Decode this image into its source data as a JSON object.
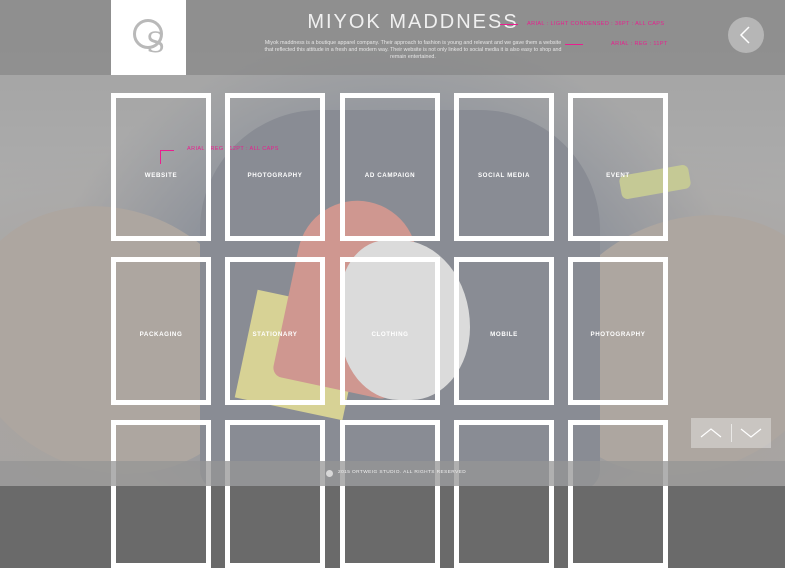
{
  "header": {
    "logo_text": "OS",
    "title": "MIYOK MADDNESS",
    "description": "Miyok maddness is a boutique apparel company. Their approach to fashion is young and relevant and we gave them a website that reflected this attitude in a fresh and modern way. Their website is not only linked to social media it is also easy to shop and remain entertained.",
    "annotation_title": "ARIAL : LIGHT CONDENSED : 36PT : ALL CAPS",
    "annotation_desc": "ARIAL : REG : 11PT",
    "annotation_tiles": "ARIAL : REG : 12PT : ALL CAPS"
  },
  "tiles": [
    {
      "label": "WEBSITE"
    },
    {
      "label": "PHOTOGRAPHY"
    },
    {
      "label": "AD CAMPAIGN"
    },
    {
      "label": "SOCIAL MEDIA"
    },
    {
      "label": "EVENT"
    },
    {
      "label": "PACKAGING"
    },
    {
      "label": "STATIONARY"
    },
    {
      "label": "CLOTHING"
    },
    {
      "label": "MOBILE"
    },
    {
      "label": "PHOTOGRAPHY"
    }
  ],
  "footer": {
    "copyright": "2015 ORTWEIG STUDIO. ALL RIGHTS RESERVED"
  },
  "icons": {
    "back": "chevron-left-icon",
    "up": "chevron-up-icon",
    "down": "chevron-down-icon"
  },
  "colors": {
    "annotation": "#e91e8f",
    "tile_border": "#ffffff"
  }
}
